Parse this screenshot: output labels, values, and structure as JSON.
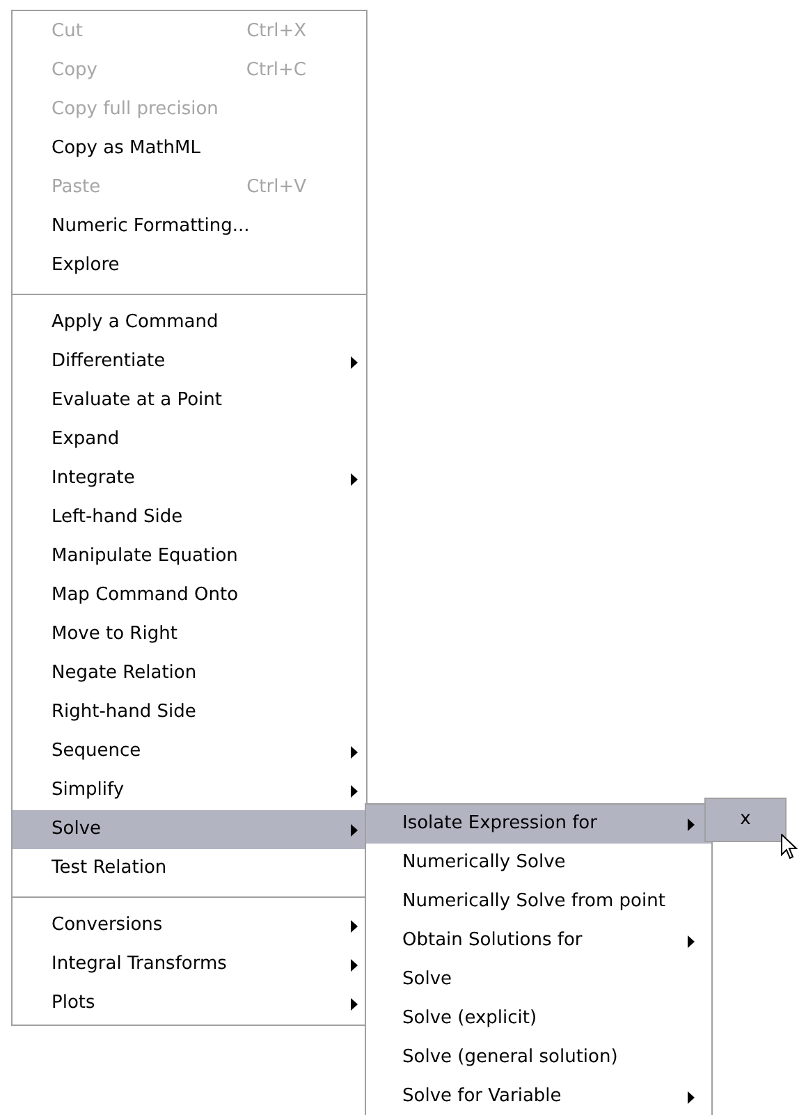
{
  "context_menu": {
    "items": [
      {
        "kind": "item",
        "label": "Cut",
        "shortcut": "Ctrl+X",
        "disabled": true,
        "has_submenu": false,
        "selected": false
      },
      {
        "kind": "item",
        "label": "Copy",
        "shortcut": "Ctrl+C",
        "disabled": true,
        "has_submenu": false,
        "selected": false
      },
      {
        "kind": "item",
        "label": "Copy full precision",
        "disabled": true,
        "has_submenu": false,
        "selected": false
      },
      {
        "kind": "item",
        "label": "Copy as MathML",
        "disabled": false,
        "has_submenu": false,
        "selected": false
      },
      {
        "kind": "item",
        "label": "Paste",
        "shortcut": "Ctrl+V",
        "disabled": true,
        "has_submenu": false,
        "selected": false
      },
      {
        "kind": "item",
        "label": "Numeric Formatting...",
        "disabled": false,
        "has_submenu": false,
        "selected": false
      },
      {
        "kind": "item",
        "label": "Explore",
        "disabled": false,
        "has_submenu": false,
        "selected": false
      },
      {
        "kind": "separator"
      },
      {
        "kind": "item",
        "label": "Apply a Command",
        "disabled": false,
        "has_submenu": false,
        "selected": false
      },
      {
        "kind": "item",
        "label": "Differentiate",
        "disabled": false,
        "has_submenu": true,
        "selected": false
      },
      {
        "kind": "item",
        "label": "Evaluate at a Point",
        "disabled": false,
        "has_submenu": false,
        "selected": false
      },
      {
        "kind": "item",
        "label": "Expand",
        "disabled": false,
        "has_submenu": false,
        "selected": false
      },
      {
        "kind": "item",
        "label": "Integrate",
        "disabled": false,
        "has_submenu": true,
        "selected": false
      },
      {
        "kind": "item",
        "label": "Left-hand Side",
        "disabled": false,
        "has_submenu": false,
        "selected": false
      },
      {
        "kind": "item",
        "label": "Manipulate Equation",
        "disabled": false,
        "has_submenu": false,
        "selected": false
      },
      {
        "kind": "item",
        "label": "Map Command Onto",
        "disabled": false,
        "has_submenu": false,
        "selected": false
      },
      {
        "kind": "item",
        "label": "Move to Right",
        "disabled": false,
        "has_submenu": false,
        "selected": false
      },
      {
        "kind": "item",
        "label": "Negate Relation",
        "disabled": false,
        "has_submenu": false,
        "selected": false
      },
      {
        "kind": "item",
        "label": "Right-hand Side",
        "disabled": false,
        "has_submenu": false,
        "selected": false
      },
      {
        "kind": "item",
        "label": "Sequence",
        "disabled": false,
        "has_submenu": true,
        "selected": false
      },
      {
        "kind": "item",
        "label": "Simplify",
        "disabled": false,
        "has_submenu": true,
        "selected": false
      },
      {
        "kind": "item",
        "label": "Solve",
        "disabled": false,
        "has_submenu": true,
        "selected": true
      },
      {
        "kind": "item",
        "label": "Test Relation",
        "disabled": false,
        "has_submenu": false,
        "selected": false
      },
      {
        "kind": "separator"
      },
      {
        "kind": "item",
        "label": "Conversions",
        "disabled": false,
        "has_submenu": true,
        "selected": false
      },
      {
        "kind": "item",
        "label": "Integral Transforms",
        "disabled": false,
        "has_submenu": true,
        "selected": false
      },
      {
        "kind": "item",
        "label": "Plots",
        "disabled": false,
        "has_submenu": true,
        "selected": false
      }
    ]
  },
  "solve_submenu": {
    "items": [
      {
        "label": "Isolate Expression for",
        "has_submenu": true,
        "selected": true
      },
      {
        "label": "Numerically Solve",
        "has_submenu": false,
        "selected": false
      },
      {
        "label": "Numerically Solve from point",
        "has_submenu": false,
        "selected": false
      },
      {
        "label": "Obtain Solutions for",
        "has_submenu": true,
        "selected": false
      },
      {
        "label": "Solve",
        "has_submenu": false,
        "selected": false
      },
      {
        "label": "Solve (explicit)",
        "has_submenu": false,
        "selected": false
      },
      {
        "label": "Solve (general solution)",
        "has_submenu": false,
        "selected": false
      },
      {
        "label": "Solve for Variable",
        "has_submenu": true,
        "selected": false
      }
    ]
  },
  "isolate_submenu": {
    "items": [
      {
        "label": "x",
        "selected": true
      }
    ]
  }
}
